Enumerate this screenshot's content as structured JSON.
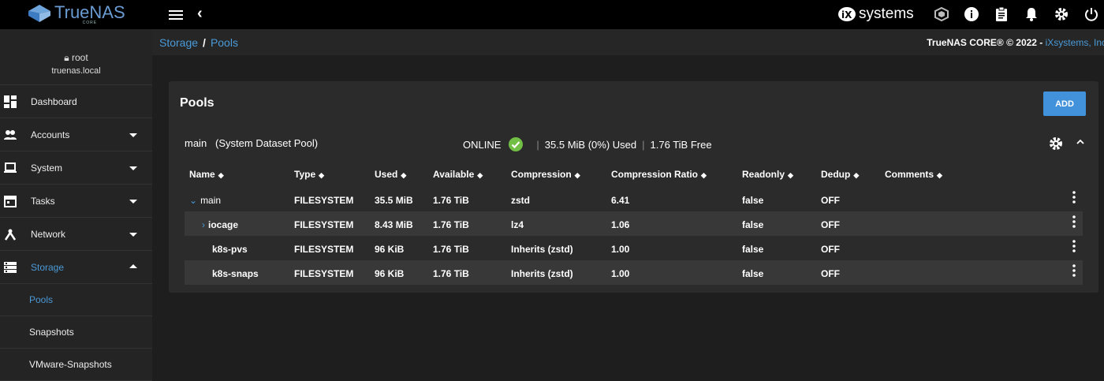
{
  "app": {
    "logo_name": "TrueNAS",
    "logo_sub": "CORE",
    "vendor_logo": "systems"
  },
  "user": {
    "name": "root",
    "host": "truenas.local"
  },
  "sidebar": {
    "items": [
      {
        "label": "Dashboard",
        "icon": "dashboard-icon"
      },
      {
        "label": "Accounts",
        "icon": "people-icon"
      },
      {
        "label": "System",
        "icon": "laptop-icon"
      },
      {
        "label": "Tasks",
        "icon": "calendar-icon"
      },
      {
        "label": "Network",
        "icon": "network-icon"
      },
      {
        "label": "Storage",
        "icon": "storage-icon"
      }
    ],
    "storage_sub": [
      "Pools",
      "Snapshots",
      "VMware-Snapshots"
    ]
  },
  "breadcrumb": {
    "root": "Storage",
    "current": "Pools"
  },
  "copyright": {
    "text": "TrueNAS CORE® © 2022 - ",
    "link": "iXsystems, Inc"
  },
  "card": {
    "title": "Pools",
    "add_label": "ADD"
  },
  "pool": {
    "name": "main",
    "role": "(System Dataset Pool)",
    "status": "ONLINE",
    "used": "35.5 MiB (0%) Used",
    "free": "1.76 TiB Free"
  },
  "table": {
    "headers": [
      "Name",
      "Type",
      "Used",
      "Available",
      "Compression",
      "Compression Ratio",
      "Readonly",
      "Dedup",
      "Comments"
    ],
    "rows": [
      {
        "name": "main",
        "type": "FILESYSTEM",
        "used": "35.5 MiB",
        "available": "1.76 TiB",
        "compression": "zstd",
        "ratio": "6.41",
        "readonly": "false",
        "dedup": "OFF",
        "comments": ""
      },
      {
        "name": "iocage",
        "type": "FILESYSTEM",
        "used": "8.43 MiB",
        "available": "1.76 TiB",
        "compression": "lz4",
        "ratio": "1.06",
        "readonly": "false",
        "dedup": "OFF",
        "comments": ""
      },
      {
        "name": "k8s-pvs",
        "type": "FILESYSTEM",
        "used": "96 KiB",
        "available": "1.76 TiB",
        "compression": "Inherits (zstd)",
        "ratio": "1.00",
        "readonly": "false",
        "dedup": "OFF",
        "comments": ""
      },
      {
        "name": "k8s-snaps",
        "type": "FILESYSTEM",
        "used": "96 KiB",
        "available": "1.76 TiB",
        "compression": "Inherits (zstd)",
        "ratio": "1.00",
        "readonly": "false",
        "dedup": "OFF",
        "comments": ""
      }
    ]
  },
  "colors": {
    "accent": "#4a9ad8",
    "button": "#4292db",
    "ok": "#71bf44"
  }
}
